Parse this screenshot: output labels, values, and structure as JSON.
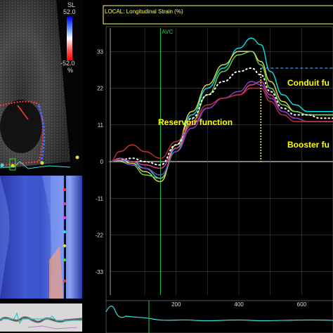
{
  "echo": {
    "scale_label": "SL",
    "scale_max": "52.0",
    "scale_min": "-52.0",
    "scale_unit": "%"
  },
  "strain_plot": {
    "header": "LOCAL: Longitudinal Strain (%)",
    "avc_label": "AVC",
    "y_ticks": [
      "33",
      "22",
      "11",
      "0",
      "-11",
      "-22",
      "-33"
    ],
    "x_ticks": [
      "200",
      "400",
      "600"
    ],
    "annotations": {
      "reservoir": "Reservoir function",
      "conduit": "Conduit fu",
      "booster": "Booster fu"
    }
  },
  "colors": {
    "annotation_text": "#ffff00",
    "avc_line": "#22cc44",
    "header_border": "#ffff66",
    "axis": "#ffffff"
  },
  "chart_data": {
    "type": "line",
    "xlabel": "",
    "ylabel": "",
    "ylim": [
      -40,
      40
    ],
    "xlim": [
      -10,
      700
    ],
    "series": [
      {
        "color": "#00e5e5",
        "x": [
          -10,
          20,
          60,
          100,
          150,
          200,
          250,
          300,
          350,
          400,
          440,
          470,
          500,
          540,
          580,
          620,
          660,
          700
        ],
        "y": [
          0,
          0.5,
          0,
          -2,
          -5,
          4,
          14,
          22,
          28,
          34,
          37,
          35,
          27,
          20,
          17,
          15,
          15,
          15
        ]
      },
      {
        "color": "#d8e04a",
        "x": [
          -10,
          20,
          60,
          100,
          150,
          200,
          250,
          300,
          350,
          400,
          440,
          470,
          500,
          540,
          580,
          620,
          660,
          700
        ],
        "y": [
          0,
          0.3,
          -0.5,
          -3,
          -6,
          5,
          15,
          23,
          29,
          33,
          33,
          30,
          24,
          18,
          15,
          14,
          14,
          14
        ]
      },
      {
        "color": "#70d050",
        "x": [
          -10,
          20,
          60,
          100,
          150,
          200,
          250,
          300,
          350,
          400,
          440,
          470,
          500,
          540,
          580,
          620,
          660,
          700
        ],
        "y": [
          0,
          0,
          -1,
          -4,
          -5,
          3,
          12,
          20,
          27,
          32,
          33,
          29,
          22,
          17,
          15,
          14,
          14,
          14
        ]
      },
      {
        "color": "#ffffff",
        "dotted": true,
        "x": [
          -10,
          20,
          60,
          100,
          150,
          200,
          250,
          300,
          350,
          400,
          440,
          470,
          500,
          540,
          580,
          620,
          660,
          700
        ],
        "y": [
          0,
          0.5,
          1,
          0,
          -1,
          5,
          13,
          20,
          24,
          27,
          28,
          26,
          21,
          16,
          14,
          14,
          13,
          13
        ]
      },
      {
        "color": "#e04090",
        "x": [
          -10,
          20,
          60,
          100,
          150,
          200,
          250,
          300,
          350,
          400,
          440,
          470,
          500,
          540,
          580,
          620,
          660,
          700
        ],
        "y": [
          0,
          1,
          0,
          -1,
          -2,
          4,
          11,
          16,
          19,
          20,
          23,
          24,
          20,
          15,
          13,
          12,
          12,
          12
        ]
      },
      {
        "color": "#8040d0",
        "x": [
          -10,
          20,
          60,
          100,
          150,
          200,
          250,
          300,
          350,
          400,
          440,
          470,
          500,
          540,
          580,
          620,
          660,
          700
        ],
        "y": [
          0,
          0.5,
          -1,
          -2,
          -4,
          3,
          10,
          16,
          19,
          21,
          24,
          23,
          19,
          15,
          13,
          12,
          12,
          12
        ]
      },
      {
        "color": "#c03030",
        "x": [
          -10,
          20,
          60,
          100,
          150,
          200,
          250,
          300,
          350,
          400,
          440,
          470,
          500,
          540,
          580,
          620,
          660,
          700
        ],
        "y": [
          0,
          3,
          5,
          3,
          1,
          6,
          12,
          17,
          19,
          20,
          22,
          22,
          18,
          14,
          12,
          12,
          12,
          12
        ]
      }
    ]
  }
}
